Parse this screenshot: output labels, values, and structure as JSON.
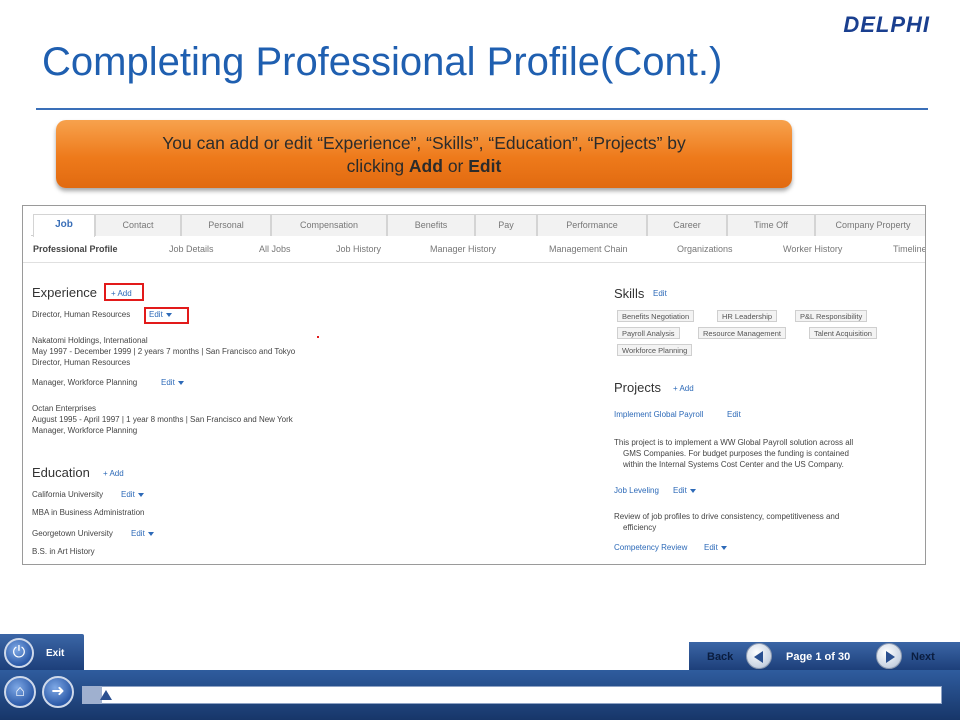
{
  "logo": "DELPHI",
  "title": "Completing Professional Profile(Cont.)",
  "callout": {
    "line1": "You can add or edit “Experience”, “Skills”, “Education”, “Projects” by",
    "line2_pre": "clicking ",
    "line2_add": "Add",
    "line2_mid": " or ",
    "line2_edit": "Edit"
  },
  "app": {
    "tabs": [
      "Job",
      "Contact",
      "Personal",
      "Compensation",
      "Benefits",
      "Pay",
      "Performance",
      "Career",
      "Time Off",
      "Company Property"
    ],
    "subnav": [
      "Professional Profile",
      "Job Details",
      "All Jobs",
      "Job History",
      "Manager History",
      "Management Chain",
      "Organizations",
      "Worker History",
      "Timeline"
    ],
    "experience": {
      "heading": "Experience",
      "add": "+ Add",
      "job1_title": "Director, Human Resources",
      "edit": "Edit",
      "job1_company": "Nakatomi Holdings, International",
      "job1_dates": "May 1997 - December 1999 | 2 years 7 months | San Francisco and Tokyo",
      "job1_role": "Director, Human Resources",
      "job2_title": "Manager, Workforce Planning",
      "job2_company": "Octan Enterprises",
      "job2_dates": "August 1995 - April 1997 | 1 year 8 months | San Francisco and New York",
      "job2_role": "Manager, Workforce Planning"
    },
    "education": {
      "heading": "Education",
      "add": "+ Add",
      "school1": "California University",
      "edit": "Edit",
      "degree1": "MBA in Business Administration",
      "school2": "Georgetown University",
      "degree2": "B.S. in Art History"
    },
    "skills": {
      "heading": "Skills",
      "edit": "Edit",
      "items": [
        "Benefits Negotiation",
        "HR Leadership",
        "P&L Responsibility",
        "Payroll Analysis",
        "Resource Management",
        "Talent Acquisition",
        "Workforce Planning"
      ]
    },
    "projects": {
      "heading": "Projects",
      "add": "+ Add",
      "p1_title": "Implement Global Payroll",
      "edit": "Edit",
      "p1_desc1": "This project is to implement a WW Global Payroll solution across all",
      "p1_desc2": "GMS Companies. For budget purposes the funding is contained",
      "p1_desc3": "within the Internal Systems Cost Center and the US Company.",
      "p2_title": "Job Leveling",
      "p2_desc1": "Review of job profiles to drive consistency, competitiveness and",
      "p2_desc2": "efficiency",
      "p3_title": "Competency Review"
    }
  },
  "nav": {
    "exit": "Exit",
    "back": "Back",
    "next": "Next",
    "page": "Page 1 of 30",
    "progress_fraction": 0.033
  }
}
